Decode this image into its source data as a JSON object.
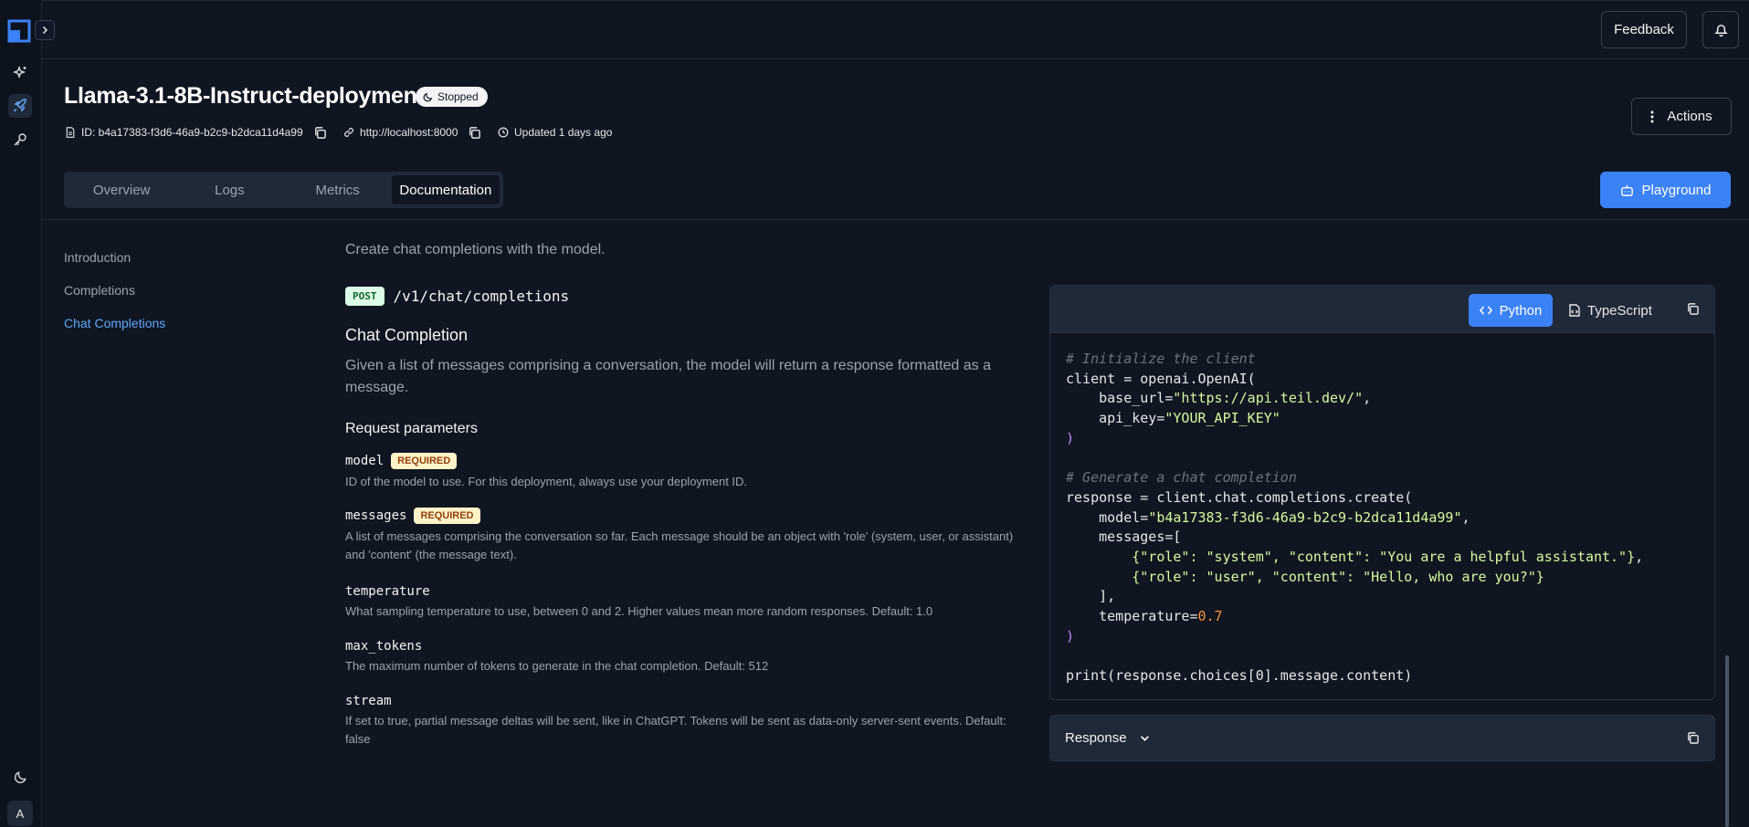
{
  "topbar": {
    "feedback_label": "Feedback"
  },
  "header": {
    "title": "Llama-3.1-8B-Instruct-deployment",
    "status": "Stopped",
    "id_text": "ID: b4a17383-f3d6-46a9-b2c9-b2dca11d4a99",
    "url_text": "http://localhost:8000",
    "updated_text": "Updated 1 days ago",
    "actions_label": "Actions"
  },
  "tabs": [
    {
      "label": "Overview"
    },
    {
      "label": "Logs"
    },
    {
      "label": "Metrics"
    },
    {
      "label": "Documentation"
    }
  ],
  "playground_label": "Playground",
  "docnav": [
    {
      "label": "Introduction"
    },
    {
      "label": "Completions"
    },
    {
      "label": "Chat Completions"
    }
  ],
  "content": {
    "lead": "Create chat completions with the model.",
    "method": "POST",
    "path": "/v1/chat/completions",
    "heading": "Chat Completion",
    "description": "Given a list of messages comprising a conversation, the model will return a response formatted as a message.",
    "params_heading": "Request parameters",
    "required_label": "REQUIRED",
    "params": [
      {
        "name": "model",
        "desc": "ID of the model to use. For this deployment, always use your deployment ID."
      },
      {
        "name": "messages",
        "desc": "A list of messages comprising the conversation so far. Each message should be an object with 'role' (system, user, or assistant) and 'content' (the message text)."
      },
      {
        "name": "temperature",
        "desc": "What sampling temperature to use, between 0 and 2. Higher values mean more random responses. Default: 1.0"
      },
      {
        "name": "max_tokens",
        "desc": "The maximum number of tokens to generate in the chat completion. Default: 512"
      },
      {
        "name": "stream",
        "desc": "If set to true, partial message deltas will be sent, like in ChatGPT. Tokens will be sent as data-only server-sent events. Default: false"
      }
    ]
  },
  "code": {
    "tabs": {
      "python": "Python",
      "typescript": "TypeScript"
    },
    "comment1": "# Initialize the client",
    "l_client": "client = openai.OpenAI(",
    "base_url_key": "    base_url=",
    "base_url_val": "\"https://api.teil.dev/\"",
    "api_key_key": "    api_key=",
    "api_key_val": "\"YOUR_API_KEY\"",
    "comment2": "# Generate a chat completion",
    "l_response": "response = client.chat.completions.create(",
    "model_key": "    model=",
    "model_val": "\"b4a17383-f3d6-46a9-b2c9-b2dca11d4a99\"",
    "messages_key": "    messages=[",
    "msg1_role": "        {\"role\": \"system\", \"content\": \"You are a helpful assistant.\"}",
    "msg2_role": "        {\"role\": \"user\", \"content\": \"Hello, who are you?\"}",
    "close_list": "    ],",
    "temp_key": "    temperature=",
    "temp_val": "0.7",
    "print_line": "print(response.choices[0].message.content)"
  },
  "response_label": "Response",
  "avatar_letter": "A"
}
